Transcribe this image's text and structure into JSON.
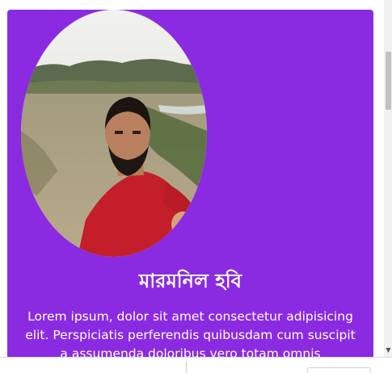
{
  "colors": {
    "card_background": "#8a2be2",
    "text": "#ffffff"
  },
  "card": {
    "image_alt": "profile photo",
    "title": "মারমনিল হবি",
    "text": "Lorem ipsum, dolor sit amet consectetur adipisicing elit. Perspiciatis perferendis quibusdam cum suscipit a assumenda doloribus vero totam omnis doloremque"
  }
}
